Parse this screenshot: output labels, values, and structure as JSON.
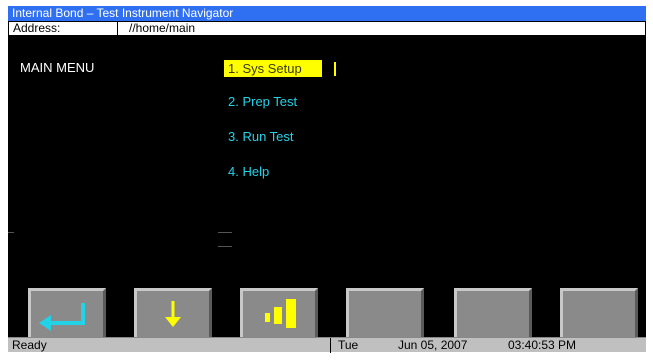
{
  "window": {
    "title": "Internal Bond – Test Instrument Navigator"
  },
  "address": {
    "label": "Address:",
    "value": "//home/main"
  },
  "main_menu": {
    "title": "MAIN MENU",
    "items": [
      {
        "label": "1. Sys Setup",
        "selected": true
      },
      {
        "label": "2. Prep Test",
        "selected": false
      },
      {
        "label": "3. Run Test",
        "selected": false
      },
      {
        "label": "4. Help",
        "selected": false
      }
    ]
  },
  "function_keys": [
    {
      "icon": "enter-arrow-icon"
    },
    {
      "icon": "down-arrow-icon"
    },
    {
      "icon": "bar-graph-icon"
    },
    {
      "icon": "blank-key"
    },
    {
      "icon": "blank-key"
    },
    {
      "icon": "blank-key"
    }
  ],
  "status": {
    "text": "Ready",
    "day": "Tue",
    "date": "Jun 05, 2007",
    "time": "03:40:53 PM"
  },
  "colors": {
    "title_bg": "#2f6ff2",
    "screen_bg": "#000000",
    "menu_text": "#22d3e8",
    "highlight": "#ffff00",
    "key_bg": "#8a8a8a",
    "status_bg": "#c0c0c0"
  }
}
